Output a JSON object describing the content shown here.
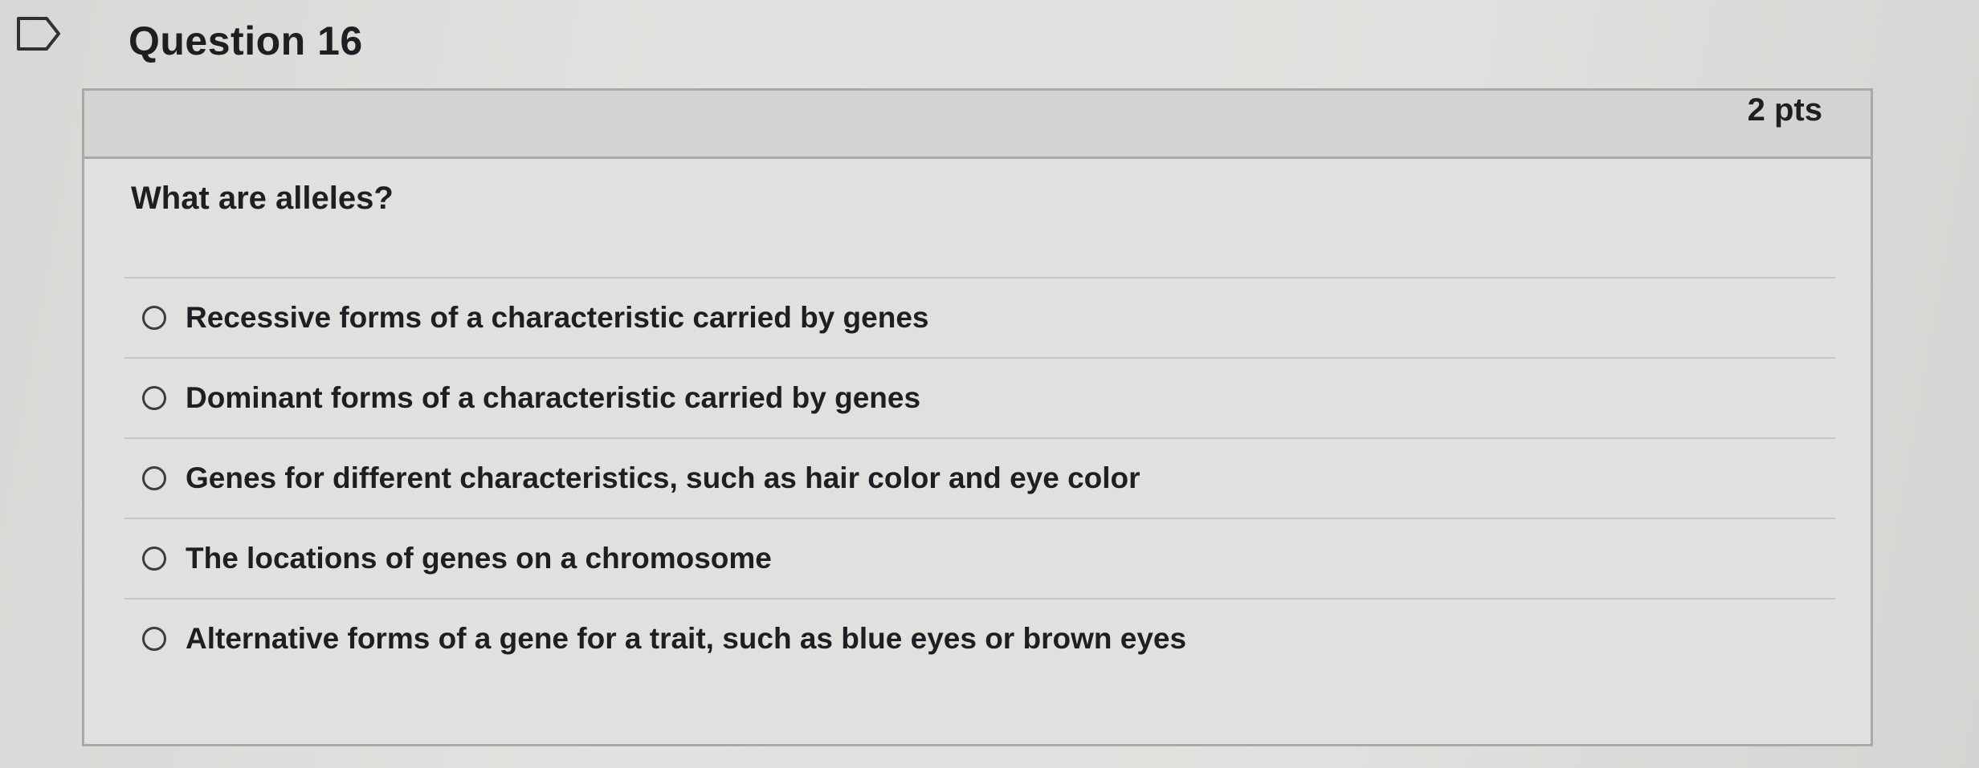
{
  "question": {
    "title": "Question 16",
    "points": "2 pts",
    "prompt": "What are alleles?",
    "answers": [
      {
        "label": "Recessive forms of a characteristic carried by genes"
      },
      {
        "label": "Dominant forms of a characteristic carried by genes"
      },
      {
        "label": "Genes for different characteristics, such as hair color and eye color"
      },
      {
        "label": "The locations of genes on a chromosome"
      },
      {
        "label": "Alternative forms of a gene for a trait, such as blue eyes or brown eyes"
      }
    ]
  }
}
